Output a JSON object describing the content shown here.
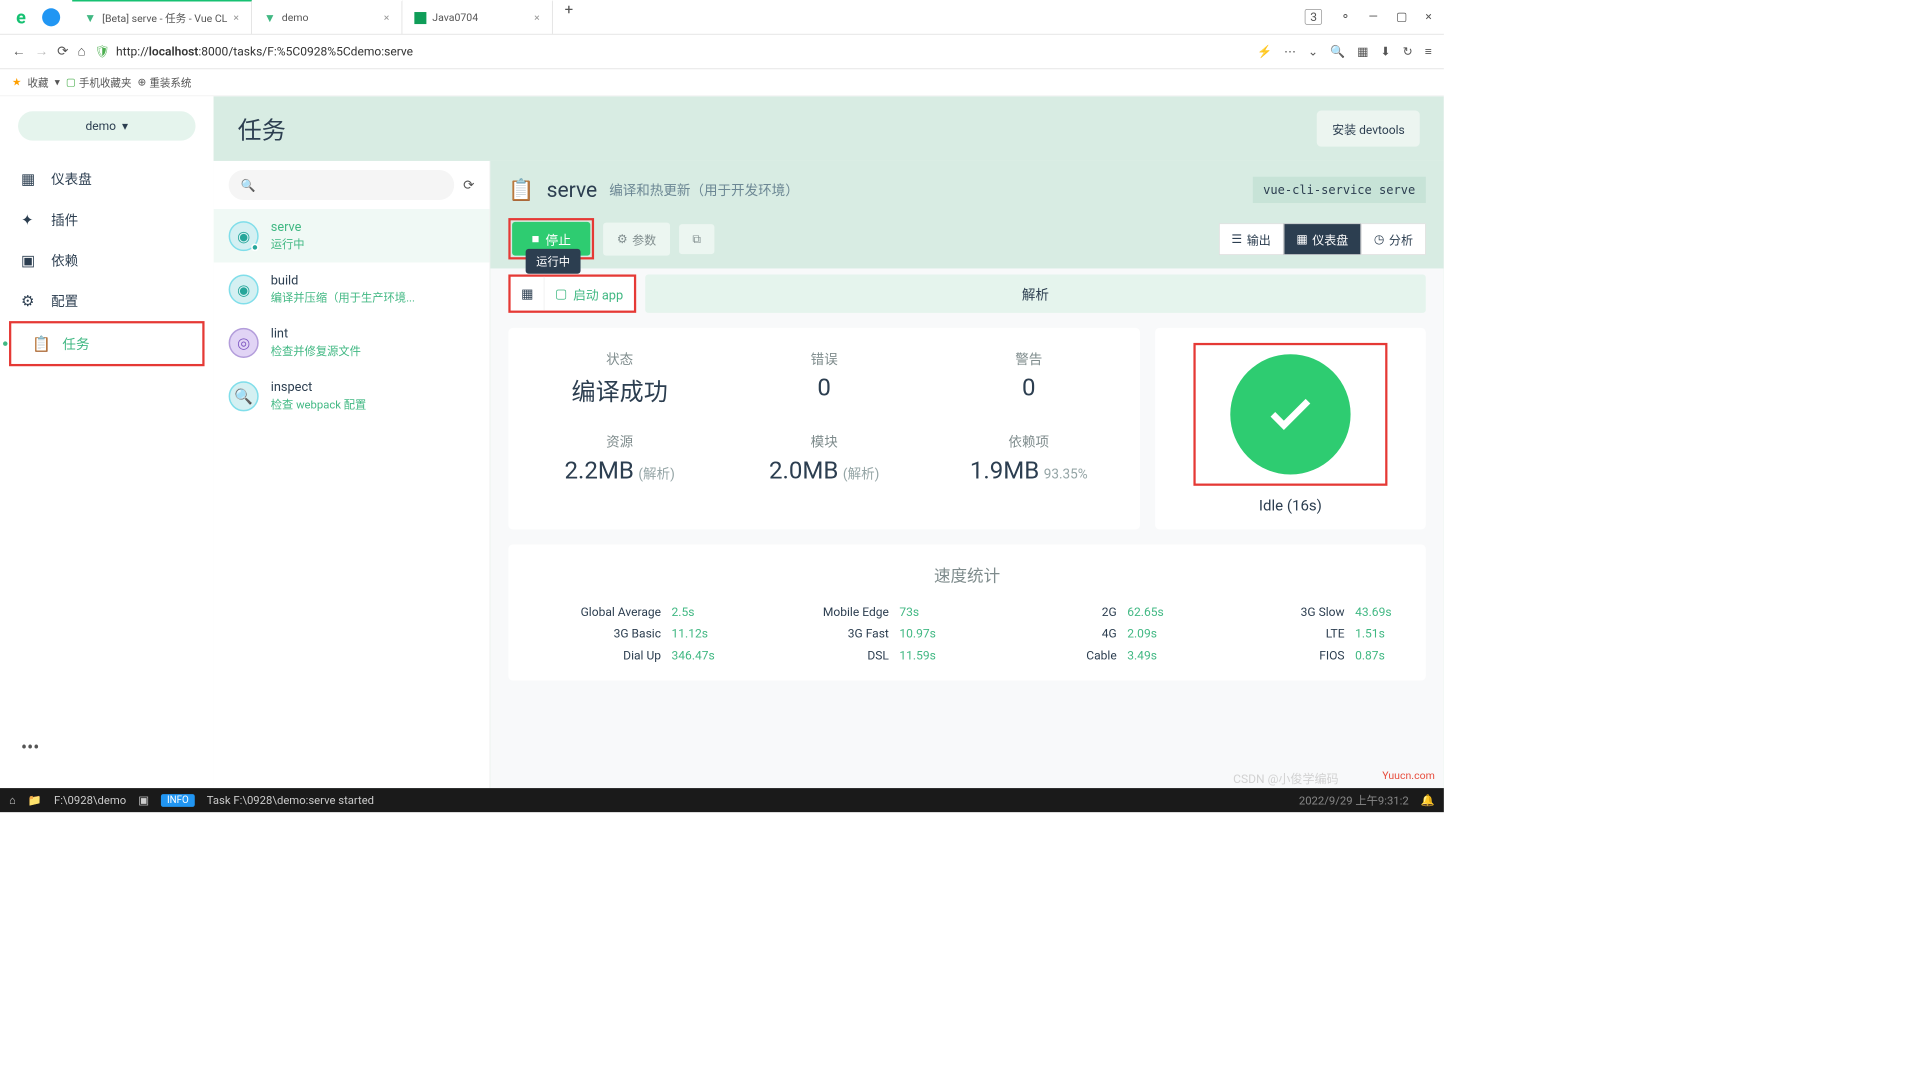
{
  "browser": {
    "tabs": [
      {
        "title": "[Beta] serve - 任务 - Vue CL",
        "icon": "vue"
      },
      {
        "title": "demo",
        "icon": "vue"
      },
      {
        "title": "Java0704",
        "icon": "sheets"
      }
    ],
    "url_prefix": "http://",
    "url_host": "localhost",
    "url_rest": ":8000/tasks/F:%5C0928%5Cdemo:serve",
    "bookmark_label": "收藏",
    "bm_mobile": "手机收藏夹",
    "bm_reinstall": "重装系统",
    "win_badge": "3"
  },
  "sidebar": {
    "project": "demo",
    "items": [
      {
        "label": "仪表盘",
        "icon": "▦"
      },
      {
        "label": "插件",
        "icon": "✦"
      },
      {
        "label": "依赖",
        "icon": "▣"
      },
      {
        "label": "配置",
        "icon": "⚙"
      },
      {
        "label": "任务",
        "icon": "📋"
      }
    ]
  },
  "header": {
    "title": "任务",
    "devtools": "安装 devtools"
  },
  "tasks": [
    {
      "name": "serve",
      "desc": "运行中",
      "state": "active",
      "icon": "cyan",
      "dot": true
    },
    {
      "name": "build",
      "desc": "编译并压缩（用于生产环境...",
      "state": "",
      "icon": "cyan"
    },
    {
      "name": "lint",
      "desc": "检查并修复源文件",
      "state": "",
      "icon": "purple"
    },
    {
      "name": "inspect",
      "desc": "检查 webpack 配置",
      "state": "",
      "icon": "cyan"
    }
  ],
  "panel": {
    "title": "serve",
    "subtitle": "编译和热更新（用于开发环境）",
    "command": "vue-cli-service serve",
    "stop": "停止",
    "tooltip": "运行中",
    "params": "参数",
    "modes": {
      "output": "输出",
      "dashboard": "仪表盘",
      "analyze": "分析"
    },
    "launch": "启动 app",
    "parse_tab": "解析"
  },
  "stats": {
    "r1": [
      {
        "label": "状态",
        "value": "编译成功",
        "sub": ""
      },
      {
        "label": "错误",
        "value": "0",
        "sub": ""
      },
      {
        "label": "警告",
        "value": "0",
        "sub": ""
      }
    ],
    "r2": [
      {
        "label": "资源",
        "value": "2.2MB",
        "sub": "(解析)"
      },
      {
        "label": "模块",
        "value": "2.0MB",
        "sub": "(解析)"
      },
      {
        "label": "依赖项",
        "value": "1.9MB",
        "sub": "93.35%"
      }
    ]
  },
  "status": {
    "idle": "Idle (16s)"
  },
  "speed": {
    "title": "速度统计",
    "items": [
      {
        "name": "Global Average",
        "val": "2.5s"
      },
      {
        "name": "Mobile Edge",
        "val": "73s"
      },
      {
        "name": "2G",
        "val": "62.65s"
      },
      {
        "name": "3G Slow",
        "val": "43.69s"
      },
      {
        "name": "3G Basic",
        "val": "11.12s"
      },
      {
        "name": "3G Fast",
        "val": "10.97s"
      },
      {
        "name": "4G",
        "val": "2.09s"
      },
      {
        "name": "LTE",
        "val": "1.51s"
      },
      {
        "name": "Dial Up",
        "val": "346.47s"
      },
      {
        "name": "DSL",
        "val": "11.59s"
      },
      {
        "name": "Cable",
        "val": "3.49s"
      },
      {
        "name": "FIOS",
        "val": "0.87s"
      }
    ]
  },
  "statusbar": {
    "path": "F:\\0928\\demo",
    "info": "INFO",
    "msg": "Task F:\\0928\\demo:serve started",
    "time": "2022/9/29  上午9:31:2",
    "csdn": "CSDN @小俊学编码"
  },
  "watermark": "Yuucn.com"
}
